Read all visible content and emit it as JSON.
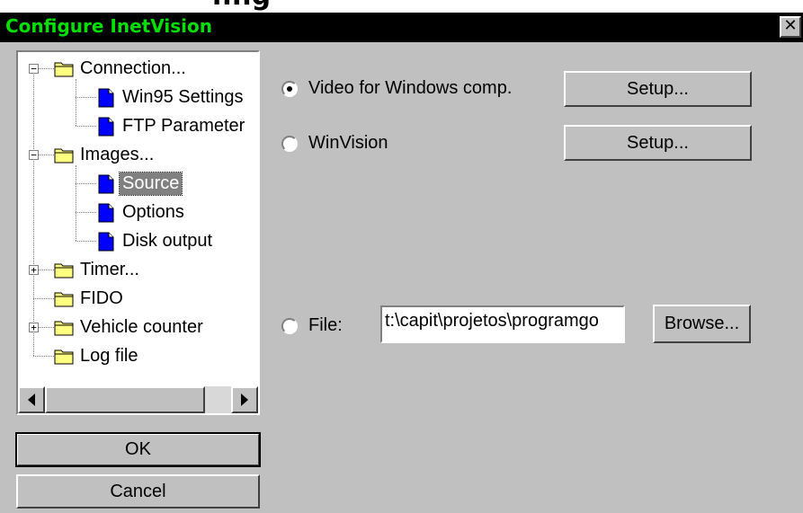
{
  "window": {
    "title": "Configure InetVision",
    "close_glyph": "✕",
    "heading_remnant": "nfig"
  },
  "tree": {
    "items": [
      {
        "label": "Connection...",
        "icon": "folder-icon",
        "expander": "−"
      },
      {
        "label": "Win95 Settings",
        "icon": "document-icon"
      },
      {
        "label": "FTP Parameter",
        "icon": "document-icon"
      },
      {
        "label": "Images...",
        "icon": "folder-icon",
        "expander": "−"
      },
      {
        "label": "Source",
        "icon": "document-icon",
        "selected": true
      },
      {
        "label": "Options",
        "icon": "document-icon"
      },
      {
        "label": "Disk output",
        "icon": "document-icon"
      },
      {
        "label": "Timer...",
        "icon": "folder-icon",
        "expander": "+"
      },
      {
        "label": "FIDO",
        "icon": "folder-icon"
      },
      {
        "label": "Vehicle counter",
        "icon": "folder-icon",
        "expander": "+"
      },
      {
        "label": "Log file",
        "icon": "folder-icon"
      }
    ]
  },
  "buttons": {
    "ok": "OK",
    "cancel": "Cancel",
    "setup_vfw": "Setup...",
    "setup_winvision": "Setup...",
    "browse": "Browse..."
  },
  "source": {
    "options": [
      {
        "label": "Video for Windows comp.",
        "checked": true
      },
      {
        "label": "WinVision",
        "checked": false
      },
      {
        "label": "File:",
        "checked": false
      }
    ],
    "file_path": "t:\\capit\\projetos\\programgo"
  },
  "colors": {
    "title_bar": "#000000",
    "title_text": "#00e000",
    "window_bg": "#c0c0c0",
    "selection": "#808080",
    "folder": "#ffff80",
    "document": "#0000ff"
  }
}
